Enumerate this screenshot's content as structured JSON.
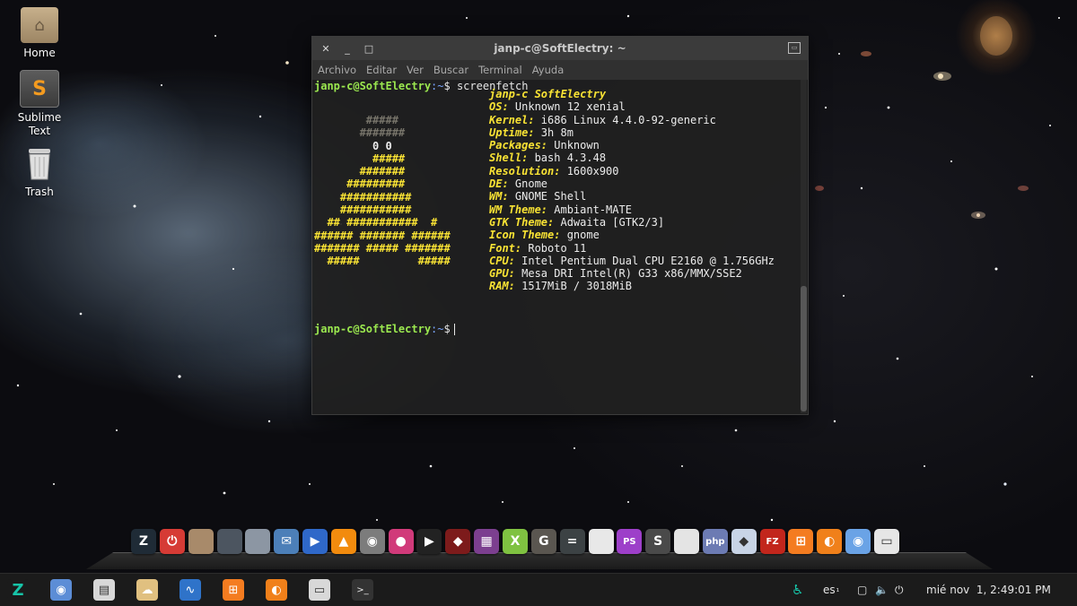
{
  "desktop": {
    "icons": [
      {
        "label": "Home"
      },
      {
        "label": "Sublime\nText"
      },
      {
        "label": "Trash"
      }
    ]
  },
  "terminal": {
    "title": "janp-c@SoftElectry: ~",
    "menu": [
      "Archivo",
      "Editar",
      "Ver",
      "Buscar",
      "Terminal",
      "Ayuda"
    ],
    "prompt_user": "janp-c@SoftElectry",
    "prompt_path": ":~",
    "prompt_symbol": "$",
    "command": " screenfetch",
    "header": "janp-c SoftElectry",
    "info": [
      {
        "key": "OS:",
        "value": " Unknown 12 xenial"
      },
      {
        "key": "Kernel:",
        "value": " i686 Linux 4.4.0-92-generic"
      },
      {
        "key": "Uptime:",
        "value": " 3h 8m"
      },
      {
        "key": "Packages:",
        "value": " Unknown"
      },
      {
        "key": "Shell:",
        "value": " bash 4.3.48"
      },
      {
        "key": "Resolution:",
        "value": " 1600x900"
      },
      {
        "key": "DE:",
        "value": " Gnome"
      },
      {
        "key": "WM:",
        "value": " GNOME Shell"
      },
      {
        "key": "WM Theme:",
        "value": " Ambiant-MATE"
      },
      {
        "key": "GTK Theme:",
        "value": " Adwaita [GTK2/3]"
      },
      {
        "key": "Icon Theme:",
        "value": " gnome"
      },
      {
        "key": "Font:",
        "value": " Roboto 11"
      },
      {
        "key": "CPU:",
        "value": " Intel Pentium Dual CPU E2160 @ 1.756GHz"
      },
      {
        "key": "GPU:",
        "value": " Mesa DRI Intel(R) G33 x86/MMX/SSE2"
      },
      {
        "key": "RAM:",
        "value": " 1517MiB / 3018MiB"
      }
    ]
  },
  "dock": {
    "icons": [
      {
        "name": "zorin-icon",
        "color": "#1f2b36",
        "glyph": "Z"
      },
      {
        "name": "power-icon",
        "color": "#d63b35",
        "glyph": "⏻"
      },
      {
        "name": "archive-icon",
        "color": "#a88a6a",
        "glyph": ""
      },
      {
        "name": "folder-dark-icon",
        "color": "#4c5560",
        "glyph": ""
      },
      {
        "name": "folder-light-icon",
        "color": "#8c96a3",
        "glyph": ""
      },
      {
        "name": "mail-icon",
        "color": "#4c7fb8",
        "glyph": "✉"
      },
      {
        "name": "media-player-icon",
        "color": "#2f68c9",
        "glyph": "▶"
      },
      {
        "name": "vlc-icon",
        "color": "#f28b0e",
        "glyph": "▲"
      },
      {
        "name": "camera-icon",
        "color": "#7c7c7c",
        "glyph": "◉"
      },
      {
        "name": "record-icon",
        "color": "#d13a7a",
        "glyph": "●"
      },
      {
        "name": "play-icon",
        "color": "#222222",
        "glyph": "▶"
      },
      {
        "name": "ruby-icon",
        "color": "#7d1b1b",
        "glyph": "◆"
      },
      {
        "name": "video-editor-icon",
        "color": "#7c3f8f",
        "glyph": "▦"
      },
      {
        "name": "xampp-green-icon",
        "color": "#7fc241",
        "glyph": "X"
      },
      {
        "name": "gimp-icon",
        "color": "#5a5650",
        "glyph": "G"
      },
      {
        "name": "calculator-icon",
        "color": "#3c4244",
        "glyph": "="
      },
      {
        "name": "document-icon",
        "color": "#e8e8e8",
        "glyph": ""
      },
      {
        "name": "phpstorm-icon",
        "color": "#9d3fc9",
        "glyph": "PS"
      },
      {
        "name": "sublime-icon",
        "color": "#4a4a4a",
        "glyph": "S"
      },
      {
        "name": "text-editor-icon",
        "color": "#e4e4e4",
        "glyph": ""
      },
      {
        "name": "php-icon",
        "color": "#6c7bb3",
        "glyph": "php"
      },
      {
        "name": "cube-icon",
        "color": "#c8d4e6",
        "glyph": "◆"
      },
      {
        "name": "filezilla-icon",
        "color": "#c2261c",
        "glyph": "FZ"
      },
      {
        "name": "xampp-icon",
        "color": "#f47c20",
        "glyph": "⊞"
      },
      {
        "name": "firefox-icon",
        "color": "#f0801a",
        "glyph": "◐"
      },
      {
        "name": "chromium-icon",
        "color": "#6aa3e6",
        "glyph": "◉"
      },
      {
        "name": "screen-icon",
        "color": "#e6e6e6",
        "glyph": "▭"
      }
    ]
  },
  "taskbar": {
    "apps": [
      {
        "name": "zorin-menu-icon",
        "color": "#1b1b1b",
        "glyph": "Z",
        "fg": "#17c4a8"
      },
      {
        "name": "chromium-task-icon",
        "color": "#5c8dd6",
        "glyph": "◉",
        "fg": "#ffffff"
      },
      {
        "name": "file-manager-task-icon",
        "color": "#d8d8d8",
        "glyph": "▤",
        "fg": "#333333"
      },
      {
        "name": "weather-task-icon",
        "color": "#e0c080",
        "glyph": "☁",
        "fg": "#ffffff"
      },
      {
        "name": "system-monitor-task-icon",
        "color": "#2f73c9",
        "glyph": "∿",
        "fg": "#ffffff"
      },
      {
        "name": "xampp-task-icon",
        "color": "#f47c20",
        "glyph": "⊞",
        "fg": "#ffffff"
      },
      {
        "name": "firefox-task-icon",
        "color": "#f0801a",
        "glyph": "◐",
        "fg": "#ffffff"
      },
      {
        "name": "settings-task-icon",
        "color": "#d8d8d8",
        "glyph": "▭",
        "fg": "#333333"
      },
      {
        "name": "terminal-task-icon",
        "color": "#333333",
        "glyph": ">_",
        "fg": "#e6e6e6"
      }
    ],
    "language": "es",
    "language_suffix": "₁",
    "clock": "mié nov  1, 2:49:01 PM"
  }
}
